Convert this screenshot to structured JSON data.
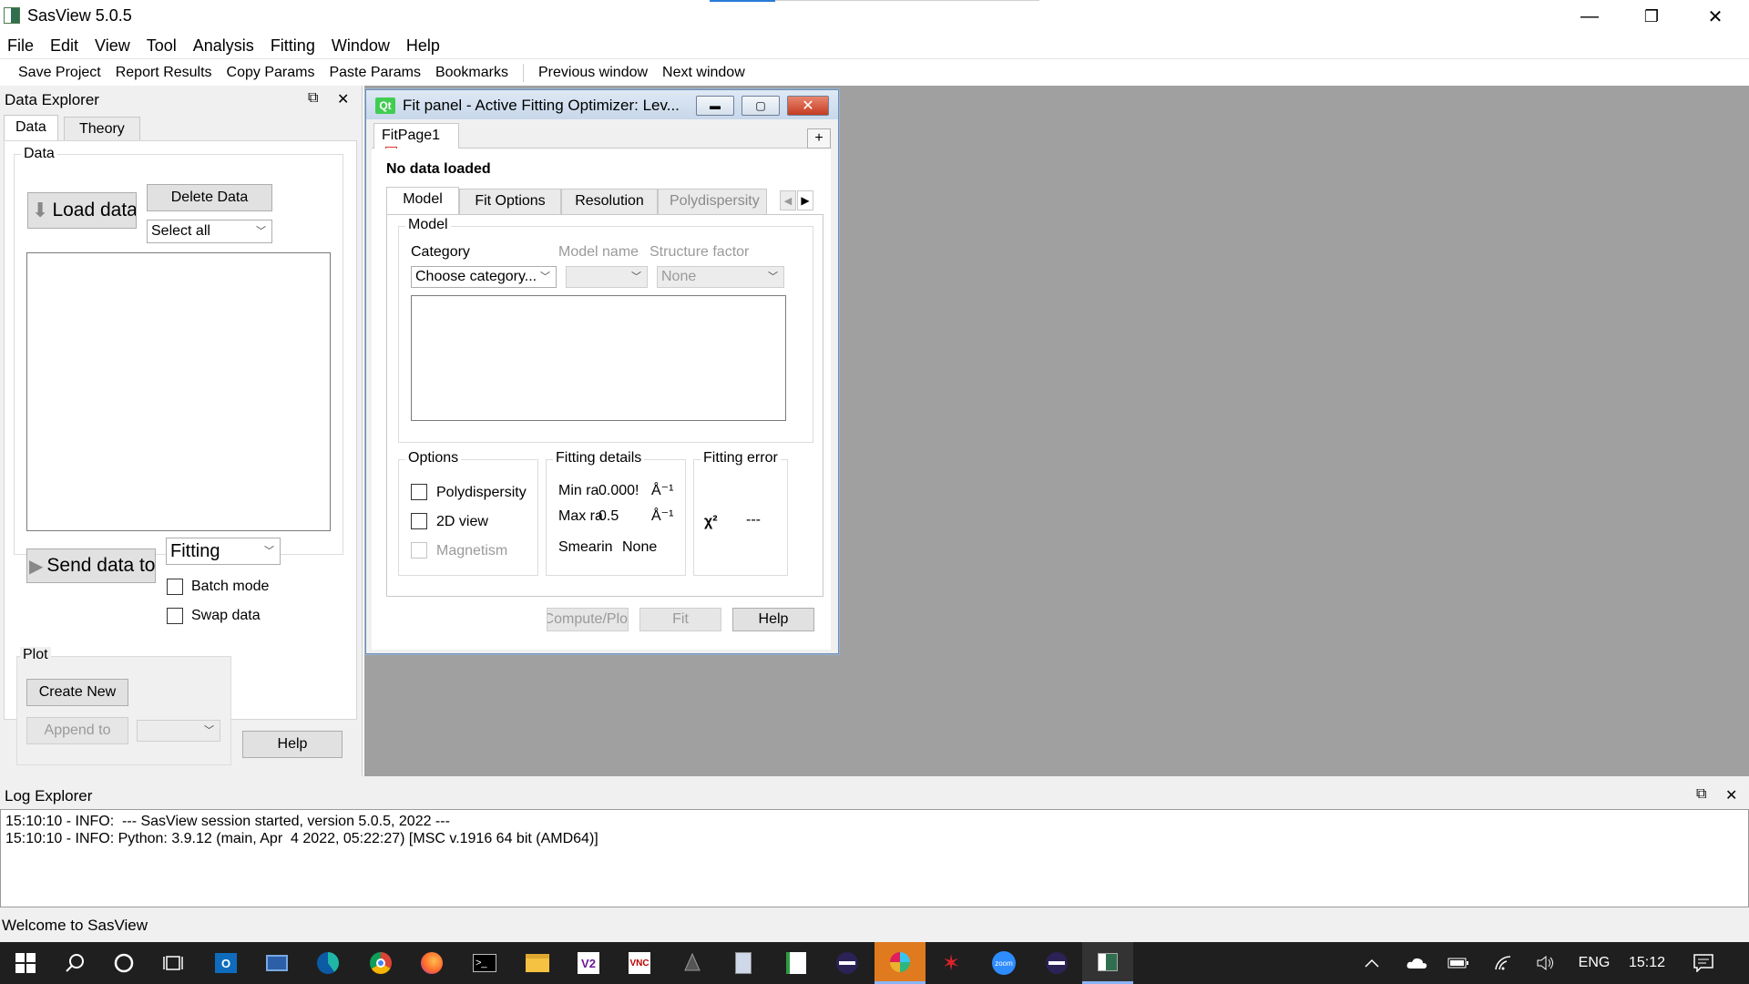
{
  "window": {
    "title": "SasView 5.0.5",
    "minimize": "—",
    "restore": "❐",
    "close": "✕"
  },
  "menu": [
    "File",
    "Edit",
    "View",
    "Tool",
    "Analysis",
    "Fitting",
    "Window",
    "Help"
  ],
  "toolbar": {
    "group1": [
      "Save Project",
      "Report Results",
      "Copy Params",
      "Paste Params",
      "Bookmarks"
    ],
    "group2": [
      "Previous window",
      "Next window"
    ]
  },
  "data_explorer": {
    "title": "Data Explorer",
    "float_icon": "⧉",
    "close_icon": "✕",
    "tabs": [
      "Data",
      "Theory"
    ],
    "data_group": "Data",
    "load_button": "Load data",
    "delete_button": "Delete Data",
    "select_combo": "Select all",
    "send_button": "Send data to",
    "perspective_combo": "Fitting",
    "batch_mode": "Batch mode",
    "swap_data": "Swap data",
    "plot_group": "Plot",
    "create_new": "Create New",
    "append_to": "Append to",
    "help": "Help"
  },
  "fit_panel": {
    "title": "Fit panel - Active Fitting Optimizer: Lev...",
    "qt_logo": "Qt",
    "tab": "FitPage1",
    "add_tab": "+",
    "status": "No data loaded",
    "subtabs": [
      "Model",
      "Fit Options",
      "Resolution",
      "Polydispersity"
    ],
    "model_group": "Model",
    "category_label": "Category",
    "model_name_label": "Model name",
    "structure_factor_label": "Structure factor",
    "category_combo": "Choose category...",
    "structure_combo": "None",
    "options_group": "Options",
    "polydispersity": "Polydispersity",
    "view_2d": "2D view",
    "magnetism": "Magnetism",
    "fitting_details_group": "Fitting details",
    "min_range_label": "Min ra",
    "min_range_value": "0.000!",
    "max_range_label": "Max ra",
    "max_range_value": "0.5",
    "unit": "Å⁻¹",
    "smearing_label": "Smearin",
    "smearing_value": "None",
    "fitting_error_group": "Fitting error",
    "chi2": "χ²",
    "chi2_value": "---",
    "compute_button": "Compute/Plot",
    "fit_button": "Fit",
    "help_button": "Help"
  },
  "log_explorer": {
    "title": "Log Explorer",
    "lines": [
      "15:10:10 - INFO:  --- SasView session started, version 5.0.5, 2022 ---",
      "15:10:10 - INFO: Python: 3.9.12 (main, Apr  4 2022, 05:22:27) [MSC v.1916 64 bit (AMD64)]"
    ]
  },
  "statusbar": {
    "text": "Welcome to SasView"
  },
  "taskbar": {
    "language": "ENG",
    "time": "15:12"
  }
}
